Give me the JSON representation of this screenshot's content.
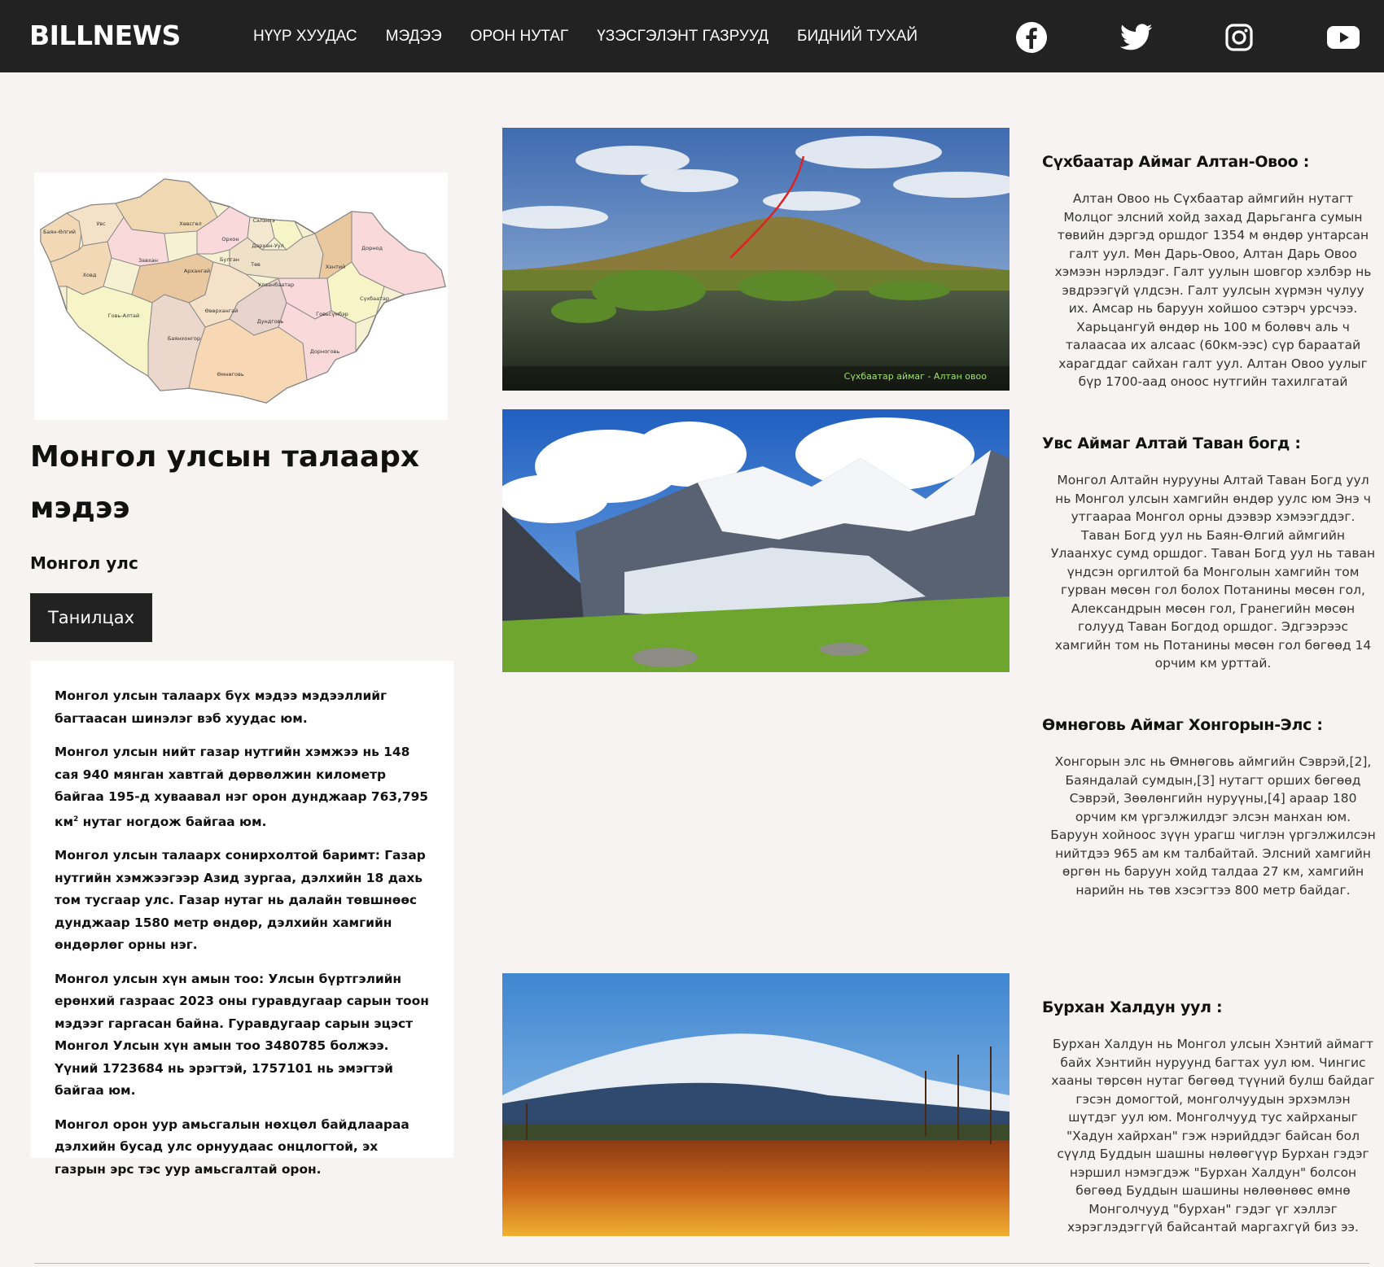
{
  "nav": {
    "brand": "BILLNEWS",
    "items": [
      "НҮҮР ХУУДАС",
      "МЭДЭЭ",
      "ОРОН НУТАГ",
      "ҮЗЭСГЭЛЭНТ ГАЗРУУД",
      "БИДНИЙ ТУХАЙ"
    ],
    "social": [
      "facebook-icon",
      "twitter-icon",
      "instagram-icon",
      "youtube-icon"
    ]
  },
  "map": {
    "regions": [
      "Баян-Өлгий",
      "Увс",
      "Хөвсгөл",
      "Сэлэнгэ",
      "Орхон",
      "Дархан-Уул",
      "Дорнод",
      "Завхан",
      "Булган",
      "Төв",
      "Хэнтий",
      "Ховд",
      "Архангай",
      "Улаанбаатар",
      "Сүхбаатар",
      "Говь-Алтай",
      "Өвөрхангай",
      "Дундговь",
      "Говьсүмбэр",
      "Баянхонгор",
      "Дорноговь",
      "Өмнөговь"
    ]
  },
  "intro": {
    "title": "Монгол улсын талаарх мэдээ",
    "subtitle": "Монгол улс",
    "button": "Танилцах",
    "p1": "Монгол улсын талаарх бүх мэдээ мэдээллийг багтаасан шинэлэг вэб хуудас юм.",
    "p2": "Монгол улсын нийт газар нутгийн хэмжээ нь 148 сая 940 мянган хавтгай дөрвөлжин километр байгаа 195-д хуваавал нэг орон дунджаар 763,795 км",
    "p2_sup": "2",
    "p2_end": " нутаг ногдож байгаа юм.",
    "p3": "Монгол улсын талаарх сонирхолтой баримт: Газар нутгийн хэмжээгээр Азид зургаа, дэлхийн 18 дахь том тусгаар улс. Газар нутаг нь далайн төвшнөөс дунджаар 1580 метр өндөр, дэлхийн хамгийн өндөрлөг орны нэг.",
    "p4": "Монгол улсын хүн амын тоо: Улсын бүртгэлийн ерөнхий газраас 2023 оны гуравдугаар сарын тоон мэдээг гаргасан байна. Гуравдугаар сарын эцэст Монгол Улсын хүн амын тоо 3480785 болжээ. Үүний 1723684 нь эрэгтэй, 1757101 нь эмэгтэй байгаа юм.",
    "p5": "Монгол орон уур амьсгалын нөхцөл байдлаараа дэлхийн бусад улс орнуудаас онцлогтой, эх газрын эрс тэс уур амьсгалтай орон."
  },
  "photos": {
    "caption1": "Сүхбаатар аймаг - Алтан овоо"
  },
  "articles": [
    {
      "title": "Сүхбаатар Аймаг Алтан-Овоо :",
      "body": "Алтан Овоо нь Сүхбаатар аймгийн нутагт Молцог элсний хойд захад Дарьганга сумын төвийн дэргэд оршдог 1354 м өндөр унтарсан галт уул. Мөн Дарь-Овоо, Алтан Дарь Овоо хэмээн нэрлэдэг. Галт уулын шовгор хэлбэр нь эвдрээгүй үлдсэн. Галт уулсын хүрмэн чулуу их. Амсар нь баруун хойшоо сэтэрч урсчээ. Харьцангуй өндөр нь 100 м болөвч аль ч талаасаа их алсаас (60км-ээс) сүр бараатай харагддаг сайхан галт уул. Алтан Овоо уулыг бүр 1700-аад оноос нутгийн тахилгатай"
    },
    {
      "title": "Увс Аймаг Алтай Таван богд :",
      "body": "Монгол Алтайн нурууны Алтай Таван Богд уул нь Монгол улсын хамгийн өндөр уулс юм Энэ ч утгаараа Монгол орны дээвэр хэмээгддэг. Таван Богд уул нь Баян-Өлгий аймгийн Улаанхус сумд оршдог. Таван Богд уул нь таван үндсэн оргилтой ба Монголын хамгийн том гурван мөсөн гол болох Потанины мөсөн гол, Александрын мөсөн гол, Гранегийн мөсөн голууд Таван Богдод оршдог. Эдгээрээс хамгийн том нь Потанины мөсөн гол бөгөөд 14 орчим км урттай."
    },
    {
      "title": "Өмнөговь Аймаг Хонгорын-Элс :",
      "body": "Хонгорын элс нь Өмнөговь аймгийн Сэврэй,[2], Баяндалай сумдын,[3] нутагт орших бөгөөд Сэврэй, Зөөлөнгийн нуруүны,[4] араар 180 орчим км үргэлжилдэг элсэн манхан юм. Баруун хойноос зүүн урагш чиглэн үргэлжилсэн нийтдээ 965 ам км талбайтай. Элсний хамгийн өргөн нь баруун хойд талдаа 27 км, хамгийн нарийн нь төв хэсэгтээ 800 метр байдаг."
    },
    {
      "title": "Бурхан Халдун уул :",
      "body": "Бурхан Халдун нь Монгол улсын Хэнтий аймагт байх Хэнтийн нуруунд багтах уул юм. Чингис хааны төрсөн нутаг бөгөөд түүний булш байдаг гэсэн домогтой, монголчуудын эрхэмлэн шүтдэг уул юм. Монголчууд тус хайрханыг \"Хадун хайрхан\" гэж нэрийддэг байсан бол сүүлд Буддын шашны нөлөөгүүр Бурхан гэдэг нэршил нэмэгдэж \"Бурхан Халдун\" болсон бөгөөд Буддын шашины нөлөөнөөс өмнө Монголчууд \"бурхан\" гэдэг үг хэллэг хэрэглэдэггүй байсантай маргахгүй биз ээ."
    }
  ]
}
